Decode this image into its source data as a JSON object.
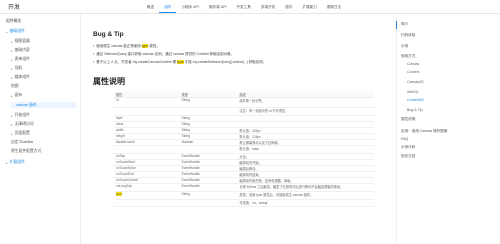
{
  "app": {
    "logo": "开发"
  },
  "topnav": [
    {
      "label": "概述",
      "active": false
    },
    {
      "label": "组件",
      "active": true
    },
    {
      "label": "小程序 API",
      "active": false
    },
    {
      "label": "服务端 API",
      "active": false
    },
    {
      "label": "开发工具",
      "active": false
    },
    {
      "label": "多端开发",
      "active": false
    },
    {
      "label": "插件",
      "active": false
    },
    {
      "label": "扩展能力",
      "active": false
    },
    {
      "label": "更新日志",
      "active": false
    }
  ],
  "sidebar": {
    "items": [
      {
        "label": "组件概览",
        "level": 1,
        "arrow": false
      },
      {
        "label": "基础组件",
        "level": 1,
        "arrow": true,
        "hl": true
      },
      {
        "label": "视图容器",
        "level": 2,
        "arrow": true
      },
      {
        "label": "基础内容",
        "level": 2,
        "arrow": true
      },
      {
        "label": "表单组件",
        "level": 2,
        "arrow": true
      },
      {
        "label": "导航",
        "level": 2,
        "arrow": true
      },
      {
        "label": "媒体组件",
        "level": 2,
        "arrow": true
      },
      {
        "label": "地图",
        "level": 2,
        "arrow": false
      },
      {
        "label": "画布",
        "level": 2,
        "arrow": true
      },
      {
        "label": "canvas 画布",
        "level": 3,
        "arrow": false,
        "active": true
      },
      {
        "label": "开放组件",
        "level": 2,
        "arrow": true
      },
      {
        "label": "无障碍访问",
        "level": 2,
        "arrow": true
      },
      {
        "label": "页面配置",
        "level": 2,
        "arrow": true
      },
      {
        "label": "自定义tabBar",
        "level": 2,
        "arrow": false
      },
      {
        "label": "原生组件配置方式",
        "level": 2,
        "arrow": false
      },
      {
        "label": "扩展组件",
        "level": 1,
        "arrow": true,
        "hl": true
      }
    ]
  },
  "main": {
    "bug_title": "Bug & Tip",
    "bullets": [
      {
        "before": "使用原生 canvas 能正常使用 ",
        "mark": "type",
        "after": " 属性。"
      },
      {
        "before": "通过 SelectorQuery 接口获取 canvas 实例。通过 canvas 提供的 Context 获取绘制对象。",
        "mark": "",
        "after": ""
      },
      {
        "before": "基于以上 2 点，开发者 my.createCanvasContext 需 ",
        "mark": "type",
        "after": " 才能 my.createSelectorQuery().select(...) 获取实例。"
      }
    ],
    "props_title": "属性说明",
    "table": {
      "headers": [
        "属性",
        "类型",
        "描述"
      ],
      "rows": [
        [
          "id",
          "String",
          "组件唯一标识符。"
        ],
        [
          "",
          "",
          "注意：同一页面中的 id 不可重复。"
        ],
        [
          "style",
          "String",
          ""
        ],
        [
          "class",
          "String",
          ""
        ],
        [
          "width",
          "String",
          "默认值：300px"
        ],
        [
          "height",
          "String",
          "默认值：225px"
        ],
        [
          "disable-scroll",
          "Boolean",
          "禁止屏幕滚动以及下拉刷新。"
        ],
        [
          "",
          "",
          "默认值：false"
        ],
        [
          "onTap",
          "EventHandle",
          "点击。"
        ],
        [
          "onTouchStart",
          "EventHandle",
          "触摸动作开始。"
        ],
        [
          "onTouchMove",
          "EventHandle",
          "触摸后移动。"
        ],
        [
          "onTouchEnd",
          "EventHandle",
          "触摸动作结束。"
        ],
        [
          "onTouchCancel",
          "EventHandle",
          "触摸动作被打断，如来电提醒、弹窗。"
        ],
        [
          "onLongTap",
          "EventHandle",
          "长按 500ms 之后触发，触发了长按事件后进行移动不会触发屏幕的滚动。"
        ],
        [
          "type",
          "String",
          "类型。设置 type 属性后，将使用原生 canvas 组件。"
        ],
        [
          "",
          "",
          "可选值：2d、webgl"
        ]
      ]
    }
  },
  "toc": {
    "items": [
      {
        "label": "简介",
        "level": 1
      },
      {
        "label": "扫码体验",
        "level": 1
      },
      {
        "label": "示例",
        "level": 1
      },
      {
        "label": "使用方式",
        "level": 1
      },
      {
        "label": "Canvas",
        "level": 2
      },
      {
        "label": "Context",
        "level": 2
      },
      {
        "label": "Canvas2D",
        "level": 2
      },
      {
        "label": "WebGL",
        "level": 2
      },
      {
        "label": "Context2D",
        "level": 2,
        "active": true
      },
      {
        "label": "Bug & Tip",
        "level": 2
      },
      {
        "label": "属性说明",
        "level": 1
      },
      {
        "label": "实例：使用 Canvas 操作图像",
        "level": 1
      },
      {
        "label": "FAQ",
        "level": 1
      },
      {
        "label": "示例代码",
        "level": 1
      },
      {
        "label": "相关文档",
        "level": 1
      }
    ]
  }
}
